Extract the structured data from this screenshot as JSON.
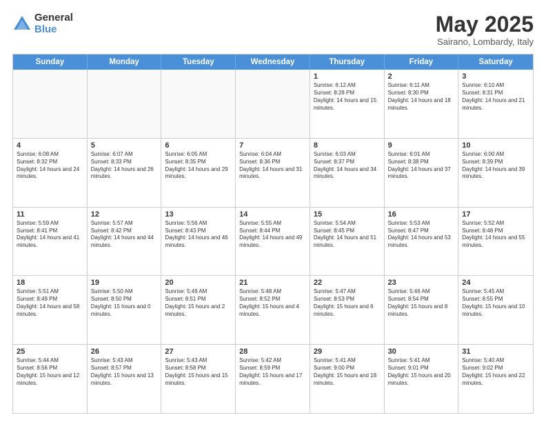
{
  "logo": {
    "general": "General",
    "blue": "Blue"
  },
  "title": "May 2025",
  "subtitle": "Sairano, Lombardy, Italy",
  "header_days": [
    "Sunday",
    "Monday",
    "Tuesday",
    "Wednesday",
    "Thursday",
    "Friday",
    "Saturday"
  ],
  "weeks": [
    [
      {
        "day": "",
        "info": "",
        "empty": true
      },
      {
        "day": "",
        "info": "",
        "empty": true
      },
      {
        "day": "",
        "info": "",
        "empty": true
      },
      {
        "day": "",
        "info": "",
        "empty": true
      },
      {
        "day": "1",
        "info": "Sunrise: 6:12 AM\nSunset: 8:28 PM\nDaylight: 14 hours and 15 minutes."
      },
      {
        "day": "2",
        "info": "Sunrise: 6:11 AM\nSunset: 8:30 PM\nDaylight: 14 hours and 18 minutes."
      },
      {
        "day": "3",
        "info": "Sunrise: 6:10 AM\nSunset: 8:31 PM\nDaylight: 14 hours and 21 minutes."
      }
    ],
    [
      {
        "day": "4",
        "info": "Sunrise: 6:08 AM\nSunset: 8:32 PM\nDaylight: 14 hours and 24 minutes."
      },
      {
        "day": "5",
        "info": "Sunrise: 6:07 AM\nSunset: 8:33 PM\nDaylight: 14 hours and 26 minutes."
      },
      {
        "day": "6",
        "info": "Sunrise: 6:05 AM\nSunset: 8:35 PM\nDaylight: 14 hours and 29 minutes."
      },
      {
        "day": "7",
        "info": "Sunrise: 6:04 AM\nSunset: 8:36 PM\nDaylight: 14 hours and 31 minutes."
      },
      {
        "day": "8",
        "info": "Sunrise: 6:03 AM\nSunset: 8:37 PM\nDaylight: 14 hours and 34 minutes."
      },
      {
        "day": "9",
        "info": "Sunrise: 6:01 AM\nSunset: 8:38 PM\nDaylight: 14 hours and 37 minutes."
      },
      {
        "day": "10",
        "info": "Sunrise: 6:00 AM\nSunset: 8:39 PM\nDaylight: 14 hours and 39 minutes."
      }
    ],
    [
      {
        "day": "11",
        "info": "Sunrise: 5:59 AM\nSunset: 8:41 PM\nDaylight: 14 hours and 41 minutes."
      },
      {
        "day": "12",
        "info": "Sunrise: 5:57 AM\nSunset: 8:42 PM\nDaylight: 14 hours and 44 minutes."
      },
      {
        "day": "13",
        "info": "Sunrise: 5:56 AM\nSunset: 8:43 PM\nDaylight: 14 hours and 46 minutes."
      },
      {
        "day": "14",
        "info": "Sunrise: 5:55 AM\nSunset: 8:44 PM\nDaylight: 14 hours and 49 minutes."
      },
      {
        "day": "15",
        "info": "Sunrise: 5:54 AM\nSunset: 8:45 PM\nDaylight: 14 hours and 51 minutes."
      },
      {
        "day": "16",
        "info": "Sunrise: 5:53 AM\nSunset: 8:47 PM\nDaylight: 14 hours and 53 minutes."
      },
      {
        "day": "17",
        "info": "Sunrise: 5:52 AM\nSunset: 8:48 PM\nDaylight: 14 hours and 55 minutes."
      }
    ],
    [
      {
        "day": "18",
        "info": "Sunrise: 5:51 AM\nSunset: 8:49 PM\nDaylight: 14 hours and 58 minutes."
      },
      {
        "day": "19",
        "info": "Sunrise: 5:50 AM\nSunset: 8:50 PM\nDaylight: 15 hours and 0 minutes."
      },
      {
        "day": "20",
        "info": "Sunrise: 5:49 AM\nSunset: 8:51 PM\nDaylight: 15 hours and 2 minutes."
      },
      {
        "day": "21",
        "info": "Sunrise: 5:48 AM\nSunset: 8:52 PM\nDaylight: 15 hours and 4 minutes."
      },
      {
        "day": "22",
        "info": "Sunrise: 5:47 AM\nSunset: 8:53 PM\nDaylight: 15 hours and 6 minutes."
      },
      {
        "day": "23",
        "info": "Sunrise: 5:46 AM\nSunset: 8:54 PM\nDaylight: 15 hours and 8 minutes."
      },
      {
        "day": "24",
        "info": "Sunrise: 5:45 AM\nSunset: 8:55 PM\nDaylight: 15 hours and 10 minutes."
      }
    ],
    [
      {
        "day": "25",
        "info": "Sunrise: 5:44 AM\nSunset: 8:56 PM\nDaylight: 15 hours and 12 minutes."
      },
      {
        "day": "26",
        "info": "Sunrise: 5:43 AM\nSunset: 8:57 PM\nDaylight: 15 hours and 13 minutes."
      },
      {
        "day": "27",
        "info": "Sunrise: 5:43 AM\nSunset: 8:58 PM\nDaylight: 15 hours and 15 minutes."
      },
      {
        "day": "28",
        "info": "Sunrise: 5:42 AM\nSunset: 8:59 PM\nDaylight: 15 hours and 17 minutes."
      },
      {
        "day": "29",
        "info": "Sunrise: 5:41 AM\nSunset: 9:00 PM\nDaylight: 15 hours and 18 minutes."
      },
      {
        "day": "30",
        "info": "Sunrise: 5:41 AM\nSunset: 9:01 PM\nDaylight: 15 hours and 20 minutes."
      },
      {
        "day": "31",
        "info": "Sunrise: 5:40 AM\nSunset: 9:02 PM\nDaylight: 15 hours and 22 minutes."
      }
    ]
  ]
}
